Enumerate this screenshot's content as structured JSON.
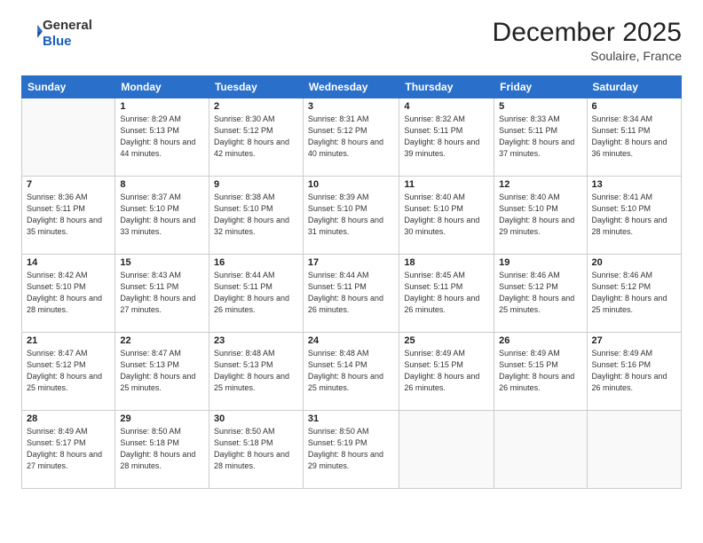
{
  "header": {
    "logo_general": "General",
    "logo_blue": "Blue",
    "month_title": "December 2025",
    "location": "Soulaire, France"
  },
  "weekdays": [
    "Sunday",
    "Monday",
    "Tuesday",
    "Wednesday",
    "Thursday",
    "Friday",
    "Saturday"
  ],
  "weeks": [
    [
      {
        "day": "",
        "sunrise": "",
        "sunset": "",
        "daylight": ""
      },
      {
        "day": "1",
        "sunrise": "Sunrise: 8:29 AM",
        "sunset": "Sunset: 5:13 PM",
        "daylight": "Daylight: 8 hours and 44 minutes."
      },
      {
        "day": "2",
        "sunrise": "Sunrise: 8:30 AM",
        "sunset": "Sunset: 5:12 PM",
        "daylight": "Daylight: 8 hours and 42 minutes."
      },
      {
        "day": "3",
        "sunrise": "Sunrise: 8:31 AM",
        "sunset": "Sunset: 5:12 PM",
        "daylight": "Daylight: 8 hours and 40 minutes."
      },
      {
        "day": "4",
        "sunrise": "Sunrise: 8:32 AM",
        "sunset": "Sunset: 5:11 PM",
        "daylight": "Daylight: 8 hours and 39 minutes."
      },
      {
        "day": "5",
        "sunrise": "Sunrise: 8:33 AM",
        "sunset": "Sunset: 5:11 PM",
        "daylight": "Daylight: 8 hours and 37 minutes."
      },
      {
        "day": "6",
        "sunrise": "Sunrise: 8:34 AM",
        "sunset": "Sunset: 5:11 PM",
        "daylight": "Daylight: 8 hours and 36 minutes."
      }
    ],
    [
      {
        "day": "7",
        "sunrise": "Sunrise: 8:36 AM",
        "sunset": "Sunset: 5:11 PM",
        "daylight": "Daylight: 8 hours and 35 minutes."
      },
      {
        "day": "8",
        "sunrise": "Sunrise: 8:37 AM",
        "sunset": "Sunset: 5:10 PM",
        "daylight": "Daylight: 8 hours and 33 minutes."
      },
      {
        "day": "9",
        "sunrise": "Sunrise: 8:38 AM",
        "sunset": "Sunset: 5:10 PM",
        "daylight": "Daylight: 8 hours and 32 minutes."
      },
      {
        "day": "10",
        "sunrise": "Sunrise: 8:39 AM",
        "sunset": "Sunset: 5:10 PM",
        "daylight": "Daylight: 8 hours and 31 minutes."
      },
      {
        "day": "11",
        "sunrise": "Sunrise: 8:40 AM",
        "sunset": "Sunset: 5:10 PM",
        "daylight": "Daylight: 8 hours and 30 minutes."
      },
      {
        "day": "12",
        "sunrise": "Sunrise: 8:40 AM",
        "sunset": "Sunset: 5:10 PM",
        "daylight": "Daylight: 8 hours and 29 minutes."
      },
      {
        "day": "13",
        "sunrise": "Sunrise: 8:41 AM",
        "sunset": "Sunset: 5:10 PM",
        "daylight": "Daylight: 8 hours and 28 minutes."
      }
    ],
    [
      {
        "day": "14",
        "sunrise": "Sunrise: 8:42 AM",
        "sunset": "Sunset: 5:10 PM",
        "daylight": "Daylight: 8 hours and 28 minutes."
      },
      {
        "day": "15",
        "sunrise": "Sunrise: 8:43 AM",
        "sunset": "Sunset: 5:11 PM",
        "daylight": "Daylight: 8 hours and 27 minutes."
      },
      {
        "day": "16",
        "sunrise": "Sunrise: 8:44 AM",
        "sunset": "Sunset: 5:11 PM",
        "daylight": "Daylight: 8 hours and 26 minutes."
      },
      {
        "day": "17",
        "sunrise": "Sunrise: 8:44 AM",
        "sunset": "Sunset: 5:11 PM",
        "daylight": "Daylight: 8 hours and 26 minutes."
      },
      {
        "day": "18",
        "sunrise": "Sunrise: 8:45 AM",
        "sunset": "Sunset: 5:11 PM",
        "daylight": "Daylight: 8 hours and 26 minutes."
      },
      {
        "day": "19",
        "sunrise": "Sunrise: 8:46 AM",
        "sunset": "Sunset: 5:12 PM",
        "daylight": "Daylight: 8 hours and 25 minutes."
      },
      {
        "day": "20",
        "sunrise": "Sunrise: 8:46 AM",
        "sunset": "Sunset: 5:12 PM",
        "daylight": "Daylight: 8 hours and 25 minutes."
      }
    ],
    [
      {
        "day": "21",
        "sunrise": "Sunrise: 8:47 AM",
        "sunset": "Sunset: 5:12 PM",
        "daylight": "Daylight: 8 hours and 25 minutes."
      },
      {
        "day": "22",
        "sunrise": "Sunrise: 8:47 AM",
        "sunset": "Sunset: 5:13 PM",
        "daylight": "Daylight: 8 hours and 25 minutes."
      },
      {
        "day": "23",
        "sunrise": "Sunrise: 8:48 AM",
        "sunset": "Sunset: 5:13 PM",
        "daylight": "Daylight: 8 hours and 25 minutes."
      },
      {
        "day": "24",
        "sunrise": "Sunrise: 8:48 AM",
        "sunset": "Sunset: 5:14 PM",
        "daylight": "Daylight: 8 hours and 25 minutes."
      },
      {
        "day": "25",
        "sunrise": "Sunrise: 8:49 AM",
        "sunset": "Sunset: 5:15 PM",
        "daylight": "Daylight: 8 hours and 26 minutes."
      },
      {
        "day": "26",
        "sunrise": "Sunrise: 8:49 AM",
        "sunset": "Sunset: 5:15 PM",
        "daylight": "Daylight: 8 hours and 26 minutes."
      },
      {
        "day": "27",
        "sunrise": "Sunrise: 8:49 AM",
        "sunset": "Sunset: 5:16 PM",
        "daylight": "Daylight: 8 hours and 26 minutes."
      }
    ],
    [
      {
        "day": "28",
        "sunrise": "Sunrise: 8:49 AM",
        "sunset": "Sunset: 5:17 PM",
        "daylight": "Daylight: 8 hours and 27 minutes."
      },
      {
        "day": "29",
        "sunrise": "Sunrise: 8:50 AM",
        "sunset": "Sunset: 5:18 PM",
        "daylight": "Daylight: 8 hours and 28 minutes."
      },
      {
        "day": "30",
        "sunrise": "Sunrise: 8:50 AM",
        "sunset": "Sunset: 5:18 PM",
        "daylight": "Daylight: 8 hours and 28 minutes."
      },
      {
        "day": "31",
        "sunrise": "Sunrise: 8:50 AM",
        "sunset": "Sunset: 5:19 PM",
        "daylight": "Daylight: 8 hours and 29 minutes."
      },
      {
        "day": "",
        "sunrise": "",
        "sunset": "",
        "daylight": ""
      },
      {
        "day": "",
        "sunrise": "",
        "sunset": "",
        "daylight": ""
      },
      {
        "day": "",
        "sunrise": "",
        "sunset": "",
        "daylight": ""
      }
    ]
  ]
}
